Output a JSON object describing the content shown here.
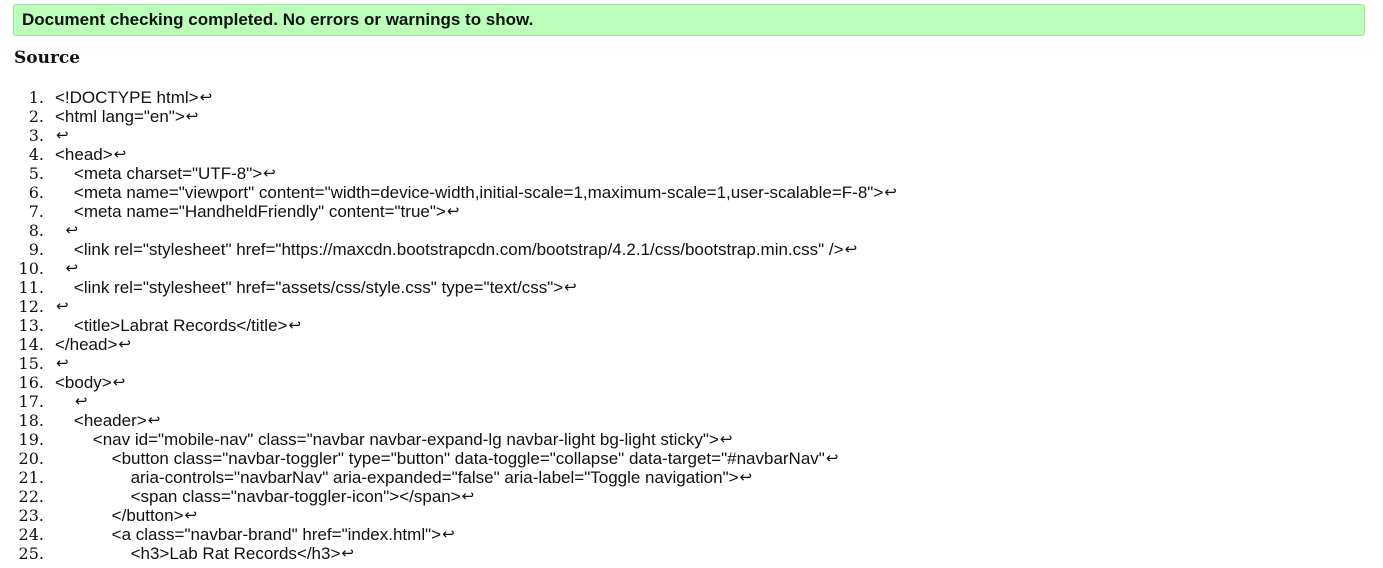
{
  "status": {
    "message": "Document checking completed. No errors or warnings to show."
  },
  "source": {
    "heading": "Source",
    "return_glyph": "↩",
    "lines": [
      {
        "num": "1.",
        "code": "<!DOCTYPE html>"
      },
      {
        "num": "2.",
        "code": "<html lang=\"en\">"
      },
      {
        "num": "3.",
        "code": ""
      },
      {
        "num": "4.",
        "code": "<head>"
      },
      {
        "num": "5.",
        "code": "    <meta charset=\"UTF-8\">"
      },
      {
        "num": "6.",
        "code": "    <meta name=\"viewport\" content=\"width=device-width,initial-scale=1,maximum-scale=1,user-scalable=F-8\">"
      },
      {
        "num": "7.",
        "code": "    <meta name=\"HandheldFriendly\" content=\"true\">"
      },
      {
        "num": "8.",
        "code": "  "
      },
      {
        "num": "9.",
        "code": "    <link rel=\"stylesheet\" href=\"https://maxcdn.bootstrapcdn.com/bootstrap/4.2.1/css/bootstrap.min.css\" />"
      },
      {
        "num": "10.",
        "code": "  "
      },
      {
        "num": "11.",
        "code": "    <link rel=\"stylesheet\" href=\"assets/css/style.css\" type=\"text/css\">"
      },
      {
        "num": "12.",
        "code": ""
      },
      {
        "num": "13.",
        "code": "    <title>Labrat Records</title>"
      },
      {
        "num": "14.",
        "code": "</head>"
      },
      {
        "num": "15.",
        "code": ""
      },
      {
        "num": "16.",
        "code": "<body>"
      },
      {
        "num": "17.",
        "code": "    "
      },
      {
        "num": "18.",
        "code": "    <header>"
      },
      {
        "num": "19.",
        "code": "        <nav id=\"mobile-nav\" class=\"navbar navbar-expand-lg navbar-light bg-light sticky\">"
      },
      {
        "num": "20.",
        "code": "            <button class=\"navbar-toggler\" type=\"button\" data-toggle=\"collapse\" data-target=\"#navbarNav\""
      },
      {
        "num": "21.",
        "code": "                aria-controls=\"navbarNav\" aria-expanded=\"false\" aria-label=\"Toggle navigation\">"
      },
      {
        "num": "22.",
        "code": "                <span class=\"navbar-toggler-icon\"></span>"
      },
      {
        "num": "23.",
        "code": "            </button>"
      },
      {
        "num": "24.",
        "code": "            <a class=\"navbar-brand\" href=\"index.html\">"
      },
      {
        "num": "25.",
        "code": "                <h3>Lab Rat Records</h3>"
      }
    ]
  }
}
